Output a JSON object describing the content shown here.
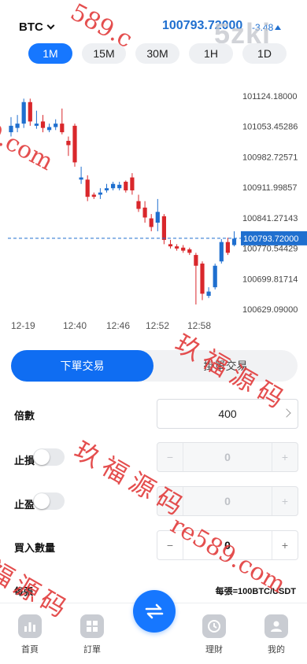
{
  "header": {
    "symbol": "BTC",
    "price": "100793.72000",
    "change": "-3.48"
  },
  "intervals": [
    "1M",
    "15M",
    "30M",
    "1H",
    "1D"
  ],
  "chart_data": {
    "type": "candlestick",
    "price_labels": [
      "101124.18000",
      "101053.45286",
      "100982.72571",
      "100911.99857",
      "100841.27143",
      "100770.54429",
      "100699.81714",
      "100629.09000"
    ],
    "current_price_label": "100793.72000",
    "x_labels": [
      "12-19",
      "12:40",
      "12:46",
      "12:52",
      "12:58"
    ],
    "ylim": [
      100629.09,
      101124.18
    ],
    "candles": [
      {
        "o": 101040,
        "c": 101055,
        "h": 101075,
        "l": 101030,
        "up": true
      },
      {
        "o": 101050,
        "c": 101060,
        "h": 101080,
        "l": 101040,
        "up": true
      },
      {
        "o": 101060,
        "c": 101110,
        "h": 101118,
        "l": 101050,
        "up": true
      },
      {
        "o": 101110,
        "c": 101065,
        "h": 101118,
        "l": 101055,
        "up": false
      },
      {
        "o": 101055,
        "c": 101060,
        "h": 101090,
        "l": 101048,
        "up": true
      },
      {
        "o": 101065,
        "c": 101050,
        "h": 101080,
        "l": 101040,
        "up": false
      },
      {
        "o": 101045,
        "c": 101052,
        "h": 101060,
        "l": 101040,
        "up": true
      },
      {
        "o": 101052,
        "c": 101060,
        "h": 101070,
        "l": 101045,
        "up": true
      },
      {
        "o": 101060,
        "c": 101040,
        "h": 101095,
        "l": 101035,
        "up": false
      },
      {
        "o": 101020,
        "c": 101010,
        "h": 101030,
        "l": 100985,
        "up": false
      },
      {
        "o": 101055,
        "c": 100970,
        "h": 101060,
        "l": 100960,
        "up": false
      },
      {
        "o": 100930,
        "c": 100935,
        "h": 100960,
        "l": 100920,
        "up": true
      },
      {
        "o": 100930,
        "c": 100890,
        "h": 100940,
        "l": 100880,
        "up": false
      },
      {
        "o": 100895,
        "c": 100890,
        "h": 100900,
        "l": 100885,
        "up": false
      },
      {
        "o": 100895,
        "c": 100900,
        "h": 100910,
        "l": 100885,
        "up": true
      },
      {
        "o": 100905,
        "c": 100910,
        "h": 100920,
        "l": 100900,
        "up": true
      },
      {
        "o": 100910,
        "c": 100920,
        "h": 100925,
        "l": 100905,
        "up": true
      },
      {
        "o": 100910,
        "c": 100918,
        "h": 100925,
        "l": 100905,
        "up": true
      },
      {
        "o": 100925,
        "c": 100905,
        "h": 100928,
        "l": 100900,
        "up": false
      },
      {
        "o": 100935,
        "c": 100905,
        "h": 100945,
        "l": 100895,
        "up": false
      },
      {
        "o": 100880,
        "c": 100862,
        "h": 100895,
        "l": 100855,
        "up": false
      },
      {
        "o": 100865,
        "c": 100842,
        "h": 100880,
        "l": 100830,
        "up": false
      },
      {
        "o": 100840,
        "c": 100820,
        "h": 100850,
        "l": 100810,
        "up": false
      },
      {
        "o": 100830,
        "c": 100855,
        "h": 100885,
        "l": 100810,
        "up": true
      },
      {
        "o": 100845,
        "c": 100790,
        "h": 100850,
        "l": 100780,
        "up": false
      },
      {
        "o": 100780,
        "c": 100775,
        "h": 100790,
        "l": 100770,
        "up": false
      },
      {
        "o": 100775,
        "c": 100770,
        "h": 100780,
        "l": 100765,
        "up": false
      },
      {
        "o": 100772,
        "c": 100765,
        "h": 100778,
        "l": 100760,
        "up": false
      },
      {
        "o": 100768,
        "c": 100760,
        "h": 100772,
        "l": 100755,
        "up": false
      },
      {
        "o": 100755,
        "c": 100730,
        "h": 100760,
        "l": 100640,
        "up": false
      },
      {
        "o": 100735,
        "c": 100665,
        "h": 100740,
        "l": 100650,
        "up": false
      },
      {
        "o": 100660,
        "c": 100670,
        "h": 100680,
        "l": 100655,
        "up": true
      },
      {
        "o": 100680,
        "c": 100730,
        "h": 100735,
        "l": 100675,
        "up": true
      },
      {
        "o": 100740,
        "c": 100785,
        "h": 100792,
        "l": 100735,
        "up": true
      },
      {
        "o": 100785,
        "c": 100760,
        "h": 100795,
        "l": 100755,
        "up": false
      },
      {
        "o": 100778,
        "c": 100793,
        "h": 100810,
        "l": 100775,
        "up": true
      }
    ]
  },
  "trade_tabs": {
    "active": "下單交易",
    "inactive": "掛單交易"
  },
  "form": {
    "leverage_label": "倍數",
    "leverage_value": "400",
    "stop_loss_label": "止損",
    "stop_loss_value": "0",
    "take_profit_label": "止盈",
    "take_profit_value": "0",
    "quantity_label": "買入數量",
    "quantity_value": "0",
    "minus": "−",
    "plus": "+"
  },
  "per_row": {
    "left": "每張",
    "right": "每張=100BTC/USDT"
  },
  "tabbar": {
    "items": [
      {
        "label": "首頁",
        "icon": "chart-icon"
      },
      {
        "label": "訂單",
        "icon": "grid-icon"
      },
      {
        "label": "理財",
        "icon": "clock-icon"
      },
      {
        "label": "我的",
        "icon": "user-icon"
      }
    ],
    "center_icon": "swap-icon"
  },
  "watermarks": {
    "logo": "5zki",
    "url_a": "re589.com",
    "url_b": "9.com",
    "url_c": "589.c",
    "cn": "玖福源码",
    "cn_b": "福源码"
  },
  "colors": {
    "accent": "#1677ff",
    "up": "#1f6fcf",
    "down": "#d9272b",
    "watermark": "#e23b3b"
  }
}
